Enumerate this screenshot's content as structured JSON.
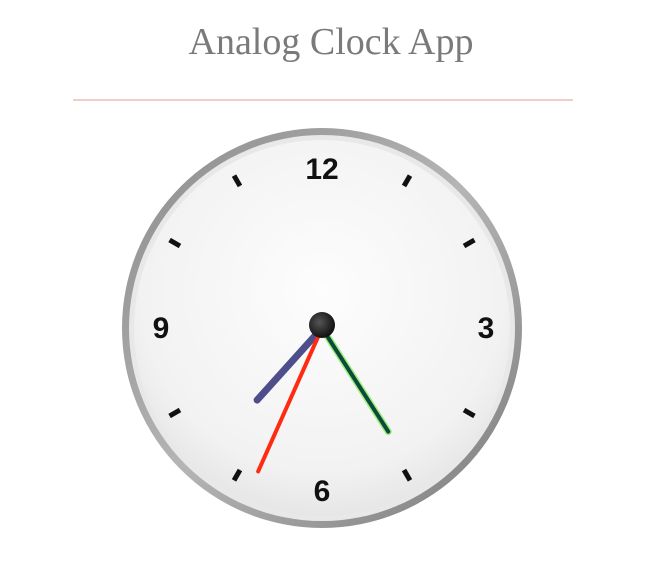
{
  "app": {
    "title": "Analog Clock App"
  },
  "clock": {
    "numerals": {
      "twelve": "12",
      "three": "3",
      "six": "6",
      "nine": "9"
    },
    "time": {
      "hours": 7,
      "minutes": 24,
      "seconds": 34
    },
    "colors": {
      "hour_hand": "#4e4e8c",
      "minute_hand": "#0d4a3c",
      "minute_hand_glow": "#9bf07a",
      "second_hand": "#ff2a12",
      "rim": "#8c8c8c",
      "face": "#f4f4f4",
      "divider": "#f3cdca",
      "title": "#7a7a7a"
    }
  }
}
